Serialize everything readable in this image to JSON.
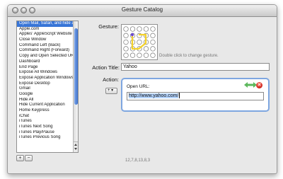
{
  "window": {
    "title": "Gesture Catalog"
  },
  "list": {
    "items": [
      "Open Mail, Safari, and hide all a",
      "Apple.com",
      "Apples' AppleScript Website",
      "Close Window",
      "Command Left (Back)",
      "Command Right (Forward)",
      "Copy and Open Selected URL",
      "Dashboard",
      "End Page",
      "Exposé All Windows",
      "Exposé Application Windows",
      "Exposé Desktop",
      "Gmail",
      "Google",
      "Hide All",
      "Hide Current Application",
      "Home Keypress",
      "iChat",
      "iTunes",
      "iTunes Next Song",
      "iTunes Play/Pause",
      "iTunes Previous Song"
    ],
    "selected_index": 0
  },
  "list_buttons": {
    "add": "+",
    "remove": "−"
  },
  "gesture": {
    "label": "Gesture:",
    "hint": "Double click to change gesture.",
    "code": "12,7,8,13,8,3"
  },
  "action_title": {
    "label": "Action Title:",
    "value": "Yahoo"
  },
  "action": {
    "label": "Action:",
    "popup_label": "+ ▾",
    "item_title": "Open URL:",
    "url": "http://www.yahoo.com/",
    "remove_symbol": "✕"
  },
  "colors": {
    "selection": "#3875d7",
    "action_border": "#7ea6e0",
    "url_highlight": "#b5d5ff",
    "gesture_line": "#f3d12b",
    "gesture_marker": "#6d4bd1",
    "stepper_green": "#5cb85c",
    "remove_red": "#d0211a"
  },
  "icons": {
    "window_controls": [
      "close-icon",
      "minimize-icon",
      "zoom-icon"
    ],
    "stepper": "green-arrows-icon",
    "remove": "remove-circle-icon"
  }
}
